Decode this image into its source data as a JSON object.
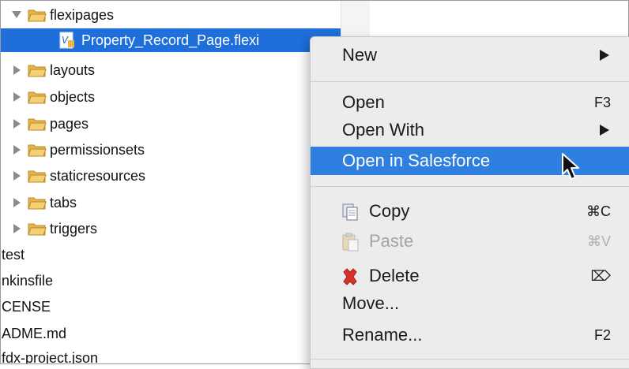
{
  "tree": {
    "items": [
      {
        "label": "flexipages",
        "expanded": true
      },
      {
        "label": "Property_Record_Page.flexi",
        "selected": true
      },
      {
        "label": "layouts"
      },
      {
        "label": "objects"
      },
      {
        "label": "pages"
      },
      {
        "label": "permissionsets"
      },
      {
        "label": "staticresources"
      },
      {
        "label": "tabs"
      },
      {
        "label": "triggers"
      },
      {
        "label": "test"
      },
      {
        "label": "nkinsfile"
      },
      {
        "label": "CENSE"
      },
      {
        "label": "ADME.md"
      },
      {
        "label": "fdx-project.json"
      }
    ]
  },
  "context_menu": {
    "items": [
      {
        "label": "New",
        "submenu": true
      },
      {
        "label": "Open",
        "shortcut": "F3"
      },
      {
        "label": "Open With",
        "submenu": true
      },
      {
        "label": "Open in Salesforce",
        "highlighted": true
      },
      {
        "label": "Copy",
        "shortcut": "⌘C",
        "icon": "copy-icon"
      },
      {
        "label": "Paste",
        "shortcut": "⌘V",
        "icon": "paste-icon",
        "disabled": true
      },
      {
        "label": "Delete",
        "shortcut": "⌦",
        "icon": "delete-icon"
      },
      {
        "label": "Move..."
      },
      {
        "label": "Rename...",
        "shortcut": "F2"
      }
    ]
  },
  "colors": {
    "selection": "#1e6fd9",
    "menu_highlight": "#2f7fe0",
    "menu_background": "#ececec",
    "folder": "#e8b54a",
    "delete": "#d9312b"
  }
}
